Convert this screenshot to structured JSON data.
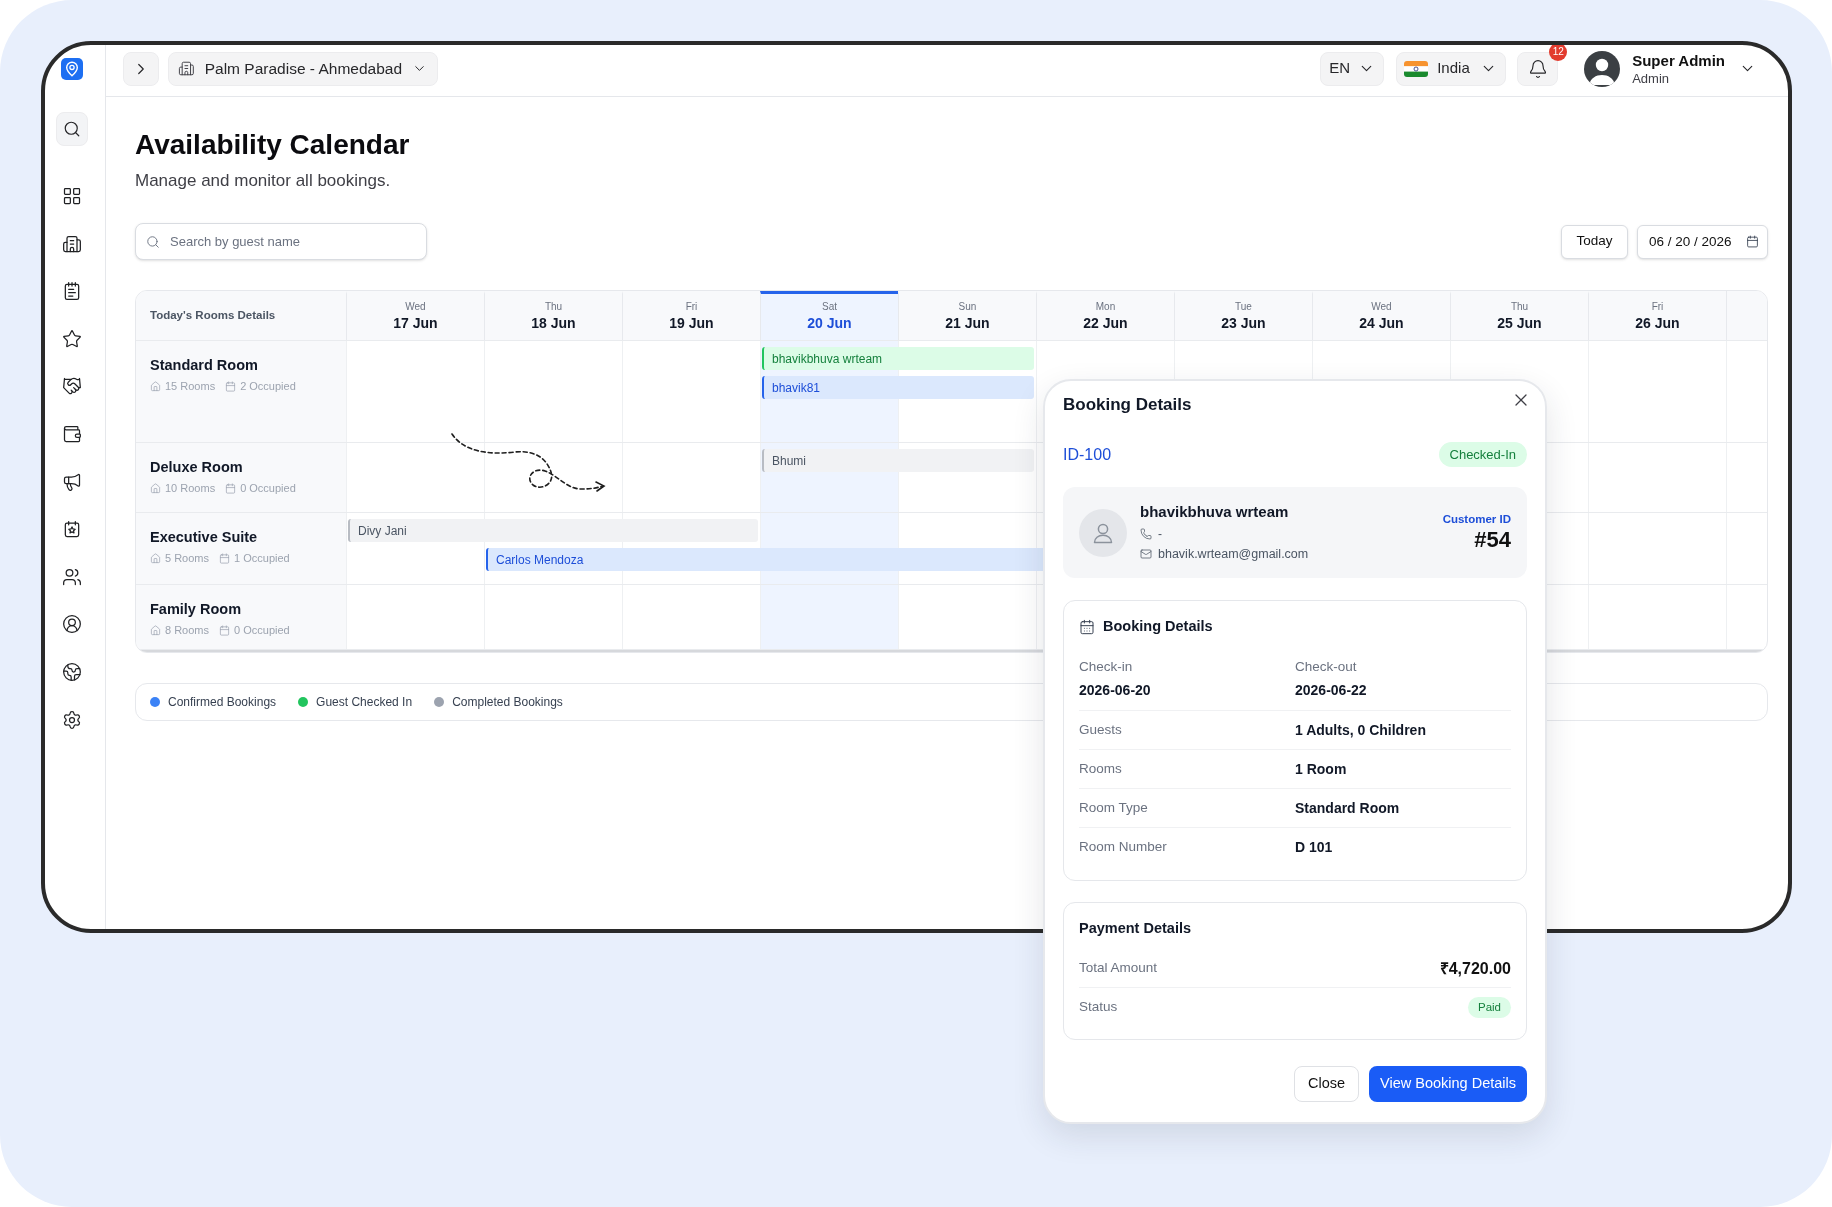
{
  "header": {
    "property": "Palm Paradise - Ahmedabad",
    "language": "EN",
    "country": "India",
    "notification_count": "12",
    "user": {
      "name": "Super Admin",
      "role": "Admin"
    }
  },
  "page": {
    "title": "Availability Calendar",
    "subtitle": "Manage and monitor all bookings."
  },
  "toolbar": {
    "search": {
      "placeholder": "Search by guest name"
    },
    "today_button": "Today",
    "date": {
      "value": "06 / 20 / 2026"
    }
  },
  "calendar": {
    "corner_label": "Today's Rooms Details",
    "days": [
      {
        "weekday": "Wed",
        "date": "17 Jun",
        "selected": false
      },
      {
        "weekday": "Thu",
        "date": "18 Jun",
        "selected": false
      },
      {
        "weekday": "Fri",
        "date": "19 Jun",
        "selected": false
      },
      {
        "weekday": "Sat",
        "date": "20 Jun",
        "selected": true
      },
      {
        "weekday": "Sun",
        "date": "21 Jun",
        "selected": false
      },
      {
        "weekday": "Mon",
        "date": "22 Jun",
        "selected": false
      },
      {
        "weekday": "Tue",
        "date": "23 Jun",
        "selected": false
      },
      {
        "weekday": "Wed",
        "date": "24 Jun",
        "selected": false
      },
      {
        "weekday": "Thu",
        "date": "25 Jun",
        "selected": false
      },
      {
        "weekday": "Fri",
        "date": "26 Jun",
        "selected": false
      }
    ],
    "rooms": [
      {
        "name": "Standard Room",
        "rooms": "15 Rooms",
        "occupied": "2 Occupied",
        "lanes": [
          [
            {
              "kind": "free"
            },
            {
              "kind": "free"
            },
            {
              "kind": "free"
            },
            {
              "kind": "checked_in",
              "guest": "bhavikbhuva wrteam"
            },
            {
              "kind": "stay"
            }
          ],
          [
            {
              "kind": "free"
            },
            {
              "kind": "free"
            },
            {
              "kind": "free"
            },
            {
              "kind": "confirmed",
              "guest": "bhavik81"
            },
            {
              "kind": "stay"
            }
          ]
        ]
      },
      {
        "name": "Deluxe Room",
        "rooms": "10 Rooms",
        "occupied": "0 Occupied",
        "lanes": [
          [
            {
              "kind": "free"
            },
            {
              "kind": "free"
            },
            {
              "kind": "free"
            },
            {
              "kind": "completed",
              "guest": "Bhumi"
            },
            {
              "kind": "stay"
            }
          ]
        ]
      },
      {
        "name": "Executive Suite",
        "rooms": "5 Rooms",
        "occupied": "1 Occupied",
        "lanes": [
          [
            {
              "kind": "completed",
              "guest": "Divy Jani"
            },
            {
              "kind": "stay"
            },
            {
              "kind": "stay"
            }
          ],
          [
            {
              "kind": "free"
            },
            {
              "kind": "confirmed",
              "guest": "Carlos Mendoza"
            },
            {
              "kind": "stay"
            },
            {
              "kind": "stay"
            },
            {
              "kind": "stay"
            },
            {
              "kind": "stay"
            }
          ]
        ]
      },
      {
        "name": "Family Room",
        "rooms": "8 Rooms",
        "occupied": "0 Occupied"
      }
    ]
  },
  "legend": [
    {
      "label": "Confirmed Bookings",
      "color": "#3b82f6"
    },
    {
      "label": "Guest Checked In",
      "color": "#22c55e"
    },
    {
      "label": "Completed Bookings",
      "color": "#9ca3af"
    }
  ],
  "booking_popup": {
    "title": "Booking Details",
    "booking_id": "ID-100",
    "status": "Checked-In",
    "guest": {
      "name": "bhavikbhuva wrteam",
      "phone": "-",
      "email": "bhavik.wrteam@gmail.com",
      "customer_id_label": "Customer ID",
      "customer_id": "#54"
    },
    "details": {
      "title": "Booking Details",
      "dates": [
        {
          "label": "Check-in",
          "value": "2026-06-20"
        },
        {
          "label": "Check-out",
          "value": "2026-06-22"
        }
      ],
      "rows": [
        {
          "label": "Guests",
          "value": "1 Adults, 0 Children"
        },
        {
          "label": "Rooms",
          "value": "1 Room"
        },
        {
          "label": "Room Type",
          "value": "Standard Room"
        },
        {
          "label": "Room Number",
          "value": "D 101"
        }
      ]
    },
    "payment": {
      "title": "Payment Details",
      "rows": [
        {
          "label": "Total Amount",
          "value": "₹4,720.00",
          "kind": "amount"
        },
        {
          "label": "Status",
          "value": "Paid",
          "kind": "badge"
        }
      ]
    },
    "buttons": [
      {
        "label": "Close",
        "kind": "secondary"
      },
      {
        "label": "View Booking Details",
        "kind": "primary"
      }
    ]
  }
}
